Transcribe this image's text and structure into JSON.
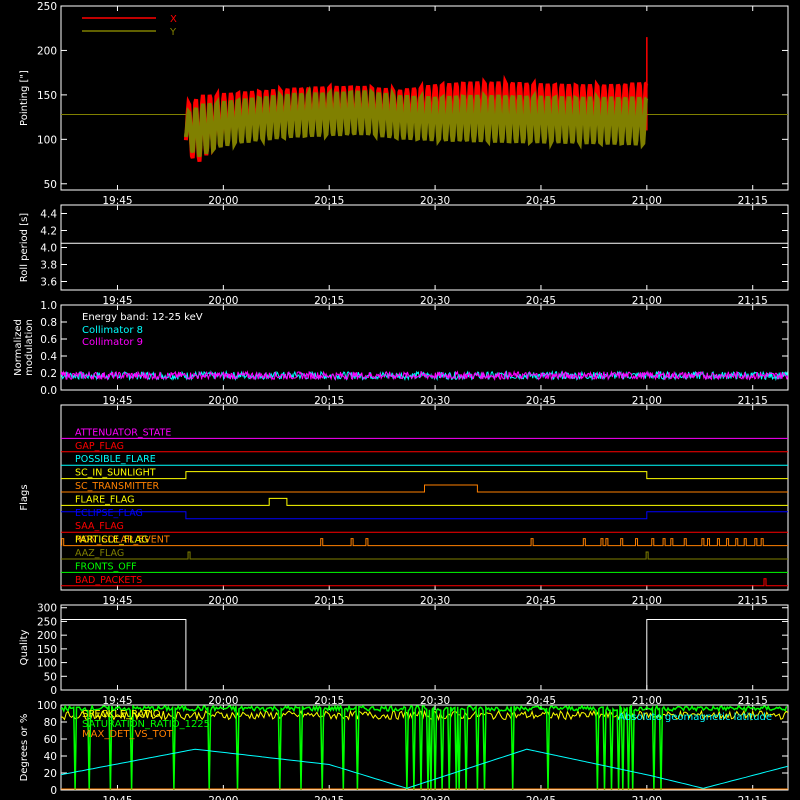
{
  "time_axis": {
    "tick_labels": [
      "19:45",
      "20:00",
      "20:15",
      "20:30",
      "20:45",
      "21:00",
      "21:15"
    ],
    "range_minutes": [
      37,
      140
    ],
    "tick_minutes": [
      45,
      60,
      75,
      90,
      105,
      120,
      135
    ]
  },
  "chart_data": [
    {
      "type": "line",
      "ylabel": "Pointing [\"]",
      "ylim": [
        43,
        250
      ],
      "yticks": [
        50,
        100,
        150,
        200,
        250
      ],
      "legend": "top-left",
      "baseline": 128,
      "series": [
        {
          "name": "X",
          "color": "#ff0000",
          "t_start": 54.7,
          "t_end": 120,
          "upper": [
            [
              54.7,
              140
            ],
            [
              57,
              150
            ],
            [
              60,
              152
            ],
            [
              65,
              155
            ],
            [
              70,
              158
            ],
            [
              75,
              160
            ],
            [
              80,
              160
            ],
            [
              85,
              156
            ],
            [
              90,
              162
            ],
            [
              95,
              165
            ],
            [
              100,
              165
            ],
            [
              105,
              163
            ],
            [
              110,
              162
            ],
            [
              115,
              162
            ],
            [
              120,
              165
            ]
          ],
          "lower": [
            [
              54.7,
              95
            ],
            [
              56,
              70
            ],
            [
              58,
              85
            ],
            [
              62,
              100
            ],
            [
              70,
              108
            ],
            [
              80,
              110
            ],
            [
              90,
              112
            ],
            [
              100,
              113
            ],
            [
              110,
              113
            ],
            [
              120,
              110
            ]
          ],
          "spike": {
            "t": 120,
            "value": 215
          }
        },
        {
          "name": "Y",
          "color": "#808000",
          "t_start": 54.7,
          "t_end": 120,
          "upper": [
            [
              54.7,
              130
            ],
            [
              57,
              140
            ],
            [
              62,
              145
            ],
            [
              70,
              152
            ],
            [
              75,
              153
            ],
            [
              80,
              155
            ],
            [
              85,
              150
            ],
            [
              90,
              148
            ],
            [
              95,
              150
            ],
            [
              100,
              150
            ],
            [
              110,
              148
            ],
            [
              120,
              148
            ]
          ],
          "lower": [
            [
              54.7,
              100
            ],
            [
              56,
              78
            ],
            [
              60,
              92
            ],
            [
              65,
              98
            ],
            [
              70,
              102
            ],
            [
              80,
              105
            ],
            [
              85,
              100
            ],
            [
              90,
              98
            ],
            [
              100,
              96
            ],
            [
              110,
              95
            ],
            [
              120,
              93
            ]
          ]
        }
      ]
    },
    {
      "type": "line",
      "ylabel": "Roll period [s]",
      "ylim": [
        3.5,
        4.5
      ],
      "yticks": [
        3.6,
        3.8,
        4.0,
        4.2,
        4.4
      ],
      "series": [
        {
          "name": "",
          "color": "#ffffff",
          "values": [
            [
              37,
              4.05
            ],
            [
              140,
              4.05
            ]
          ]
        }
      ]
    },
    {
      "type": "line",
      "ylabel": "Normalized modulation",
      "ylim": [
        0,
        1.0
      ],
      "yticks": [
        0.0,
        0.2,
        0.4,
        0.6,
        0.8,
        1.0
      ],
      "annotation": "Energy band: 12-25 keV",
      "series": [
        {
          "name": "Collimator 8",
          "color": "#00ffff",
          "mean": 0.17
        },
        {
          "name": "Collimator 9",
          "color": "#ff00ff",
          "mean": 0.17
        }
      ]
    },
    {
      "type": "line",
      "ylabel": "Flags",
      "series": [
        {
          "name": "ATTENUATOR_STATE",
          "color": "#ff00ff",
          "segments": [
            [
              37,
              0
            ],
            [
              140,
              0
            ]
          ]
        },
        {
          "name": "GAP_FLAG",
          "color": "#ff0000",
          "segments": [
            [
              37,
              0
            ],
            [
              140,
              0
            ]
          ]
        },
        {
          "name": "POSSIBLE_FLARE",
          "color": "#00ffff",
          "segments": [
            [
              37,
              0
            ],
            [
              140,
              0
            ]
          ]
        },
        {
          "name": "SC_IN_SUNLIGHT",
          "color": "#ffff00",
          "segments": [
            [
              37,
              0
            ],
            [
              54.7,
              0
            ],
            [
              54.7,
              1
            ],
            [
              120,
              1
            ],
            [
              120,
              0
            ],
            [
              140,
              0
            ]
          ]
        },
        {
          "name": "SC_TRANSMITTER",
          "color": "#ff8000",
          "segments": [
            [
              37,
              0
            ],
            [
              88.5,
              0
            ],
            [
              88.5,
              1
            ],
            [
              96,
              1
            ],
            [
              96,
              0
            ],
            [
              140,
              0
            ]
          ]
        },
        {
          "name": "FLARE_FLAG",
          "color": "#ffff00",
          "segments": [
            [
              37,
              0
            ],
            [
              66.5,
              0
            ],
            [
              66.5,
              1
            ],
            [
              69,
              1
            ],
            [
              69,
              0
            ],
            [
              140,
              0
            ]
          ]
        },
        {
          "name": "ECLIPSE_FLAG",
          "color": "#0000ff",
          "segments": [
            [
              37,
              1
            ],
            [
              54.7,
              1
            ],
            [
              54.7,
              0
            ],
            [
              120,
              0
            ],
            [
              120,
              1
            ],
            [
              140,
              1
            ]
          ]
        },
        {
          "name": "SAA_FLAG",
          "color": "#ff0000",
          "segments": [
            [
              37,
              0
            ],
            [
              140,
              0
            ]
          ]
        },
        {
          "name": "NON_SOLAR_EVENT",
          "color": "#ff8000",
          "overlap_label": "PARTICLE_FLAG",
          "spikes": [
            37.1,
            73.8,
            78.1,
            80.2,
            103.6,
            111.0,
            113.5,
            114.2,
            116.3,
            118.4,
            120.7,
            122.3,
            123.4,
            125.3,
            127.8,
            128.6,
            130.0,
            131.3,
            132.6,
            133.8,
            135.3,
            136.2
          ]
        },
        {
          "name": "AAZ_FLAG",
          "color": "#808000",
          "spikes": [
            55.0,
            119.9
          ]
        },
        {
          "name": "FRONTS_OFF",
          "color": "#00ff00",
          "segments": [
            [
              37,
              0
            ],
            [
              140,
              0
            ]
          ]
        },
        {
          "name": "BAD_PACKETS",
          "color": "#ff0000",
          "spikes": [
            136.6
          ]
        }
      ]
    },
    {
      "type": "line",
      "ylabel": "Quality",
      "ylim": [
        0,
        310
      ],
      "yticks": [
        0,
        50,
        100,
        150,
        200,
        250,
        300
      ],
      "series": [
        {
          "name": "",
          "color": "#ffffff",
          "values": [
            [
              37,
              257
            ],
            [
              54.7,
              257
            ],
            [
              54.7,
              0
            ],
            [
              120,
              0
            ],
            [
              120,
              257
            ],
            [
              140,
              257
            ]
          ]
        }
      ]
    },
    {
      "type": "line",
      "ylabel": "Degrees or %",
      "ylim": [
        0,
        100
      ],
      "yticks": [
        0,
        20,
        40,
        60,
        80,
        100
      ],
      "series": [
        {
          "name": "SPECKLE_RATIO",
          "color": "#ffff00",
          "mean": 88
        },
        {
          "name": "SATURATION_RATIO_1225",
          "color": "#00ff00",
          "mean": 96
        },
        {
          "name": "MAX_DET_VS_TOT",
          "color": "#ff8000",
          "mean": 0
        },
        {
          "name": "Absolute geomagnetic latitude",
          "color": "#00ffff",
          "values": [
            [
              37,
              18
            ],
            [
              56,
              48
            ],
            [
              75,
              30
            ],
            [
              86,
              2
            ],
            [
              103,
              48
            ],
            [
              120,
              18
            ],
            [
              128,
              2
            ],
            [
              140,
              28
            ]
          ]
        }
      ]
    }
  ]
}
